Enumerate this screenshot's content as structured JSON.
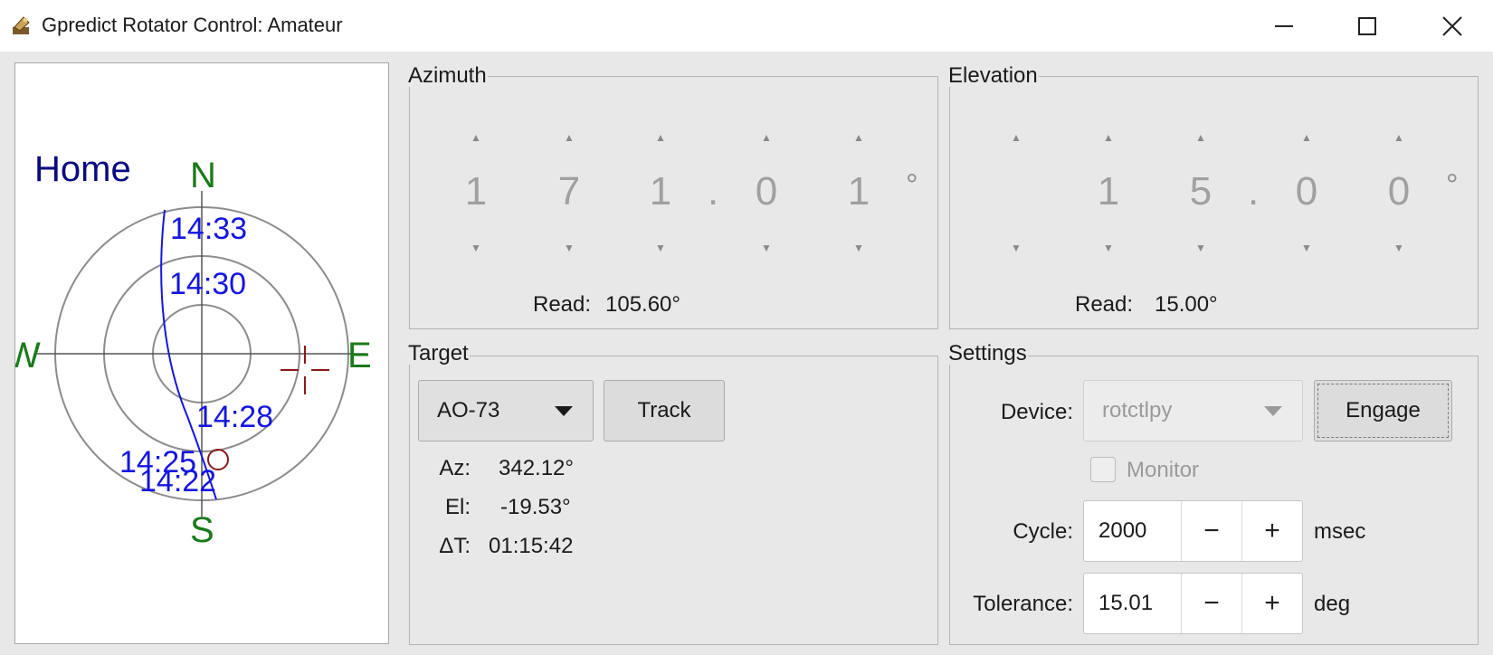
{
  "window": {
    "title": "Gpredict Rotator Control: Amateur",
    "icon": "satellite-dish-icon",
    "controls": [
      "minimize-icon",
      "maximize-icon",
      "close-icon"
    ]
  },
  "polar": {
    "home_label": "Home",
    "north": "N",
    "south": "S",
    "east": "E",
    "west": "W",
    "times": [
      "14:33",
      "14:30",
      "14:28",
      "14:25",
      "14:22"
    ],
    "colors": {
      "track": "#1515e0",
      "compass": "#1a7a1a",
      "home": "#0a0a80",
      "target_marker": "#8a1a1a"
    }
  },
  "azimuth": {
    "title": "Azimuth",
    "digits": [
      "1",
      "7",
      "1",
      ".",
      "0",
      "1"
    ],
    "unit": "°",
    "read_label": "Read:",
    "read_value": "105.60°"
  },
  "elevation": {
    "title": "Elevation",
    "digits": [
      "",
      "1",
      "5",
      ".",
      "0",
      "0"
    ],
    "unit": "°",
    "read_label": "Read:",
    "read_value": "15.00°"
  },
  "target": {
    "title": "Target",
    "satellite": "AO-73",
    "track_label": "Track",
    "az_label": "Az:",
    "az_value": "342.12°",
    "el_label": "El:",
    "el_value": "-19.53°",
    "dt_label": "ΔT:",
    "dt_value": "01:15:42"
  },
  "settings": {
    "title": "Settings",
    "device_label": "Device:",
    "device_value": "rotctlpy",
    "engage_label": "Engage",
    "monitor_label": "Monitor",
    "cycle_label": "Cycle:",
    "cycle_value": "2000",
    "cycle_unit": "msec",
    "tolerance_label": "Tolerance:",
    "tolerance_value": "15.01",
    "tolerance_unit": "deg",
    "minus": "−",
    "plus": "+"
  }
}
